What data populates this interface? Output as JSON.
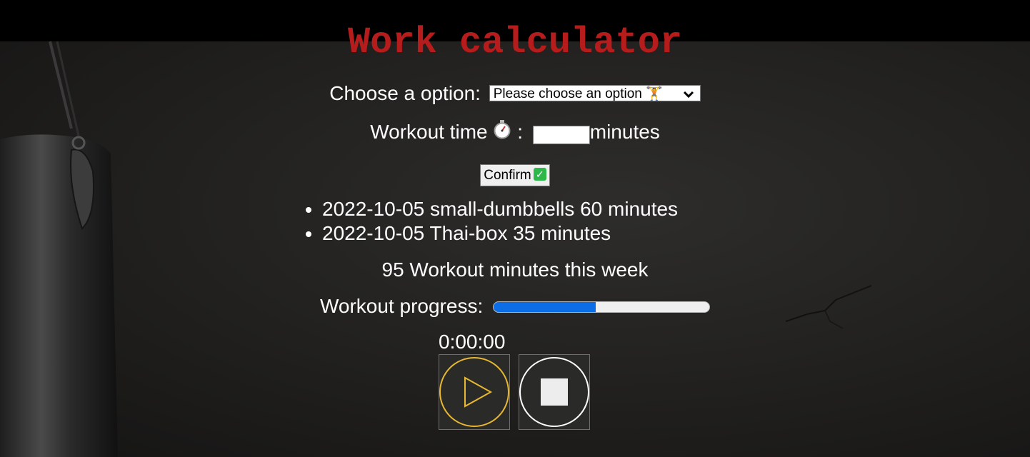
{
  "app": {
    "title": "Work calculator"
  },
  "form": {
    "option_label": "Choose a option:",
    "option_selected": "Please choose an option 🏋",
    "workout_label_prefix": "Workout time",
    "workout_label_colon": ":",
    "workout_value": "",
    "minutes_label": "minutes",
    "confirm_label": "Confirm",
    "confirm_icon_glyph": "✓"
  },
  "log": {
    "entries": [
      {
        "text": "2022-10-05 small-dumbbells 60 minutes"
      },
      {
        "text": "2022-10-05 Thai-box 35 minutes"
      }
    ]
  },
  "summary": {
    "week_minutes_text": "95 Workout minutes this week"
  },
  "progress": {
    "label": "Workout progress:",
    "value_fraction": 0.475
  },
  "stopwatch": {
    "time": "0:00:00",
    "play_icon": "play-icon",
    "stop_icon": "stop-icon"
  },
  "colors": {
    "title": "#b71c1c",
    "progress_fill": "#0c6ee6",
    "play_accent": "#e8b830",
    "stop_accent": "#ffffff",
    "confirm_check": "#2eb84b"
  },
  "icons": {
    "stopwatch": "stopwatch-icon",
    "dumbbell": "dumbbell-icon",
    "check": "checkmark-icon",
    "caret": "chevron-down-icon"
  }
}
